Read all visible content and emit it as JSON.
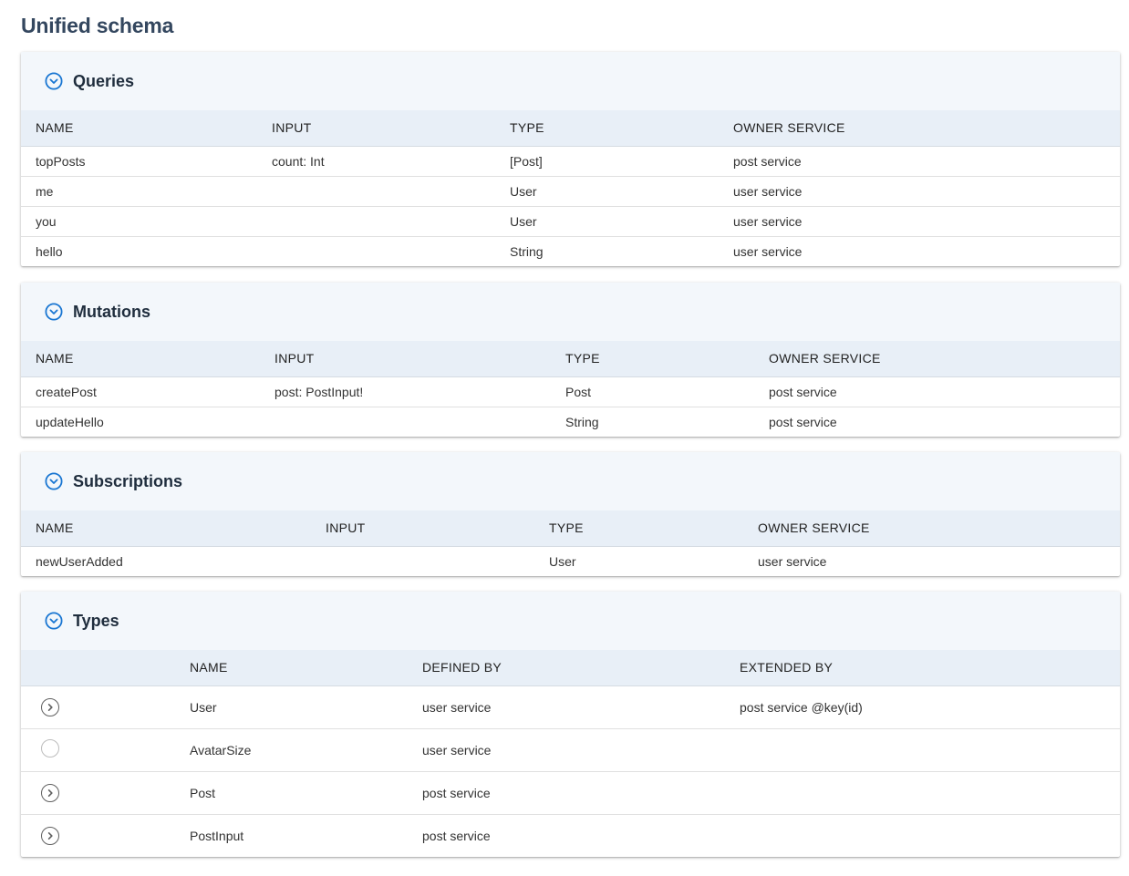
{
  "page": {
    "title": "Unified schema"
  },
  "colors": {
    "accent": "#1976d2",
    "header_bg": "#f3f7fb",
    "table_head_bg": "#e8eff7"
  },
  "icons": {
    "section_toggle": "chevron-down-circle-icon",
    "row_expand": "chevron-right-circle-icon"
  },
  "queries": {
    "title": "Queries",
    "columns": [
      "NAME",
      "INPUT",
      "TYPE",
      "OWNER SERVICE"
    ],
    "rows": [
      [
        "topPosts",
        "count: Int",
        "[Post]",
        "post service"
      ],
      [
        "me",
        "",
        "User",
        "user service"
      ],
      [
        "you",
        "",
        "User",
        "user service"
      ],
      [
        "hello",
        "",
        "String",
        "user service"
      ]
    ]
  },
  "mutations": {
    "title": "Mutations",
    "columns": [
      "NAME",
      "INPUT",
      "TYPE",
      "OWNER SERVICE"
    ],
    "rows": [
      [
        "createPost",
        "post: PostInput!",
        "Post",
        "post service"
      ],
      [
        "updateHello",
        "",
        "String",
        "post service"
      ]
    ]
  },
  "subscriptions": {
    "title": "Subscriptions",
    "columns": [
      "NAME",
      "INPUT",
      "TYPE",
      "OWNER SERVICE"
    ],
    "rows": [
      [
        "newUserAdded",
        "",
        "User",
        "user service"
      ]
    ]
  },
  "types": {
    "title": "Types",
    "columns": [
      "",
      "NAME",
      "DEFINED BY",
      "EXTENDED BY"
    ],
    "rows": [
      {
        "name": "User",
        "defined_by": "user service",
        "extended_by": "post service @key(id)",
        "expandable": true
      },
      {
        "name": "AvatarSize",
        "defined_by": "user service",
        "extended_by": "",
        "expandable": false
      },
      {
        "name": "Post",
        "defined_by": "post service",
        "extended_by": "",
        "expandable": true
      },
      {
        "name": "PostInput",
        "defined_by": "post service",
        "extended_by": "",
        "expandable": true
      }
    ]
  }
}
